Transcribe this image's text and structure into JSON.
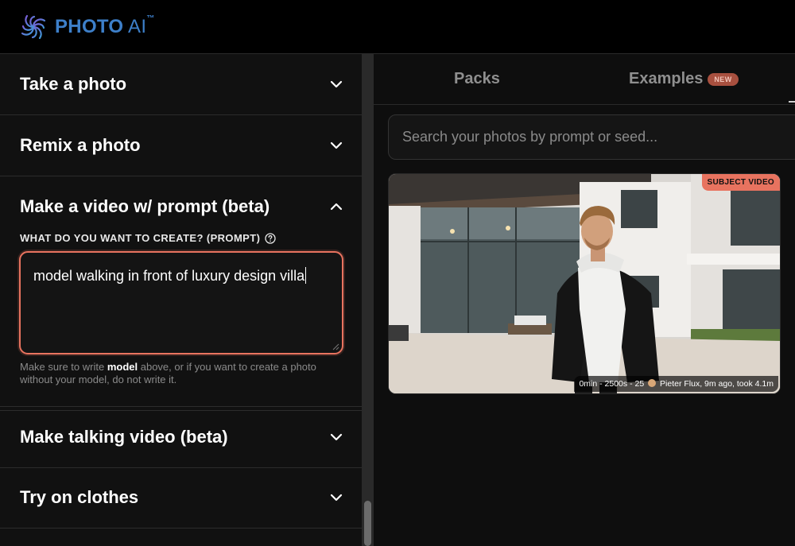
{
  "header": {
    "logo_main": "PHOTO",
    "logo_ai": " AI",
    "logo_tm": "™"
  },
  "sidebar": {
    "sections": [
      {
        "title": "Take a photo",
        "expanded": false,
        "icon": "chevron-down-icon"
      },
      {
        "title": "Remix a photo",
        "expanded": false,
        "icon": "chevron-down-icon"
      },
      {
        "title": "Make a video w/ prompt (beta)",
        "expanded": true,
        "icon": "chevron-up-icon"
      },
      {
        "title": "Make talking video (beta)",
        "expanded": false,
        "icon": "chevron-down-icon"
      },
      {
        "title": "Try on clothes",
        "expanded": false,
        "icon": "chevron-down-icon"
      }
    ],
    "prompt": {
      "label": "WHAT DO YOU WANT TO CREATE? (PROMPT)",
      "value": "model walking in front of luxury design villa",
      "hint_before": "Make sure to write ",
      "hint_bold": "model",
      "hint_after": " above, or if you want to create a photo without your model, do not write it."
    }
  },
  "main": {
    "tabs": [
      {
        "label": "Packs"
      },
      {
        "label": "Examples",
        "badge": "NEW"
      }
    ],
    "search": {
      "placeholder": "Search your photos by prompt or seed..."
    },
    "card": {
      "badge": "SUBJECT VIDEO",
      "meta_before": "0min - 2500s - 25",
      "meta_after": "Pieter Flux, 9m ago, took 4.1m"
    }
  },
  "colors": {
    "accent": "#e8735f",
    "logo_blue": "#3d7fc9",
    "badge_new_bg": "#a8503f"
  }
}
